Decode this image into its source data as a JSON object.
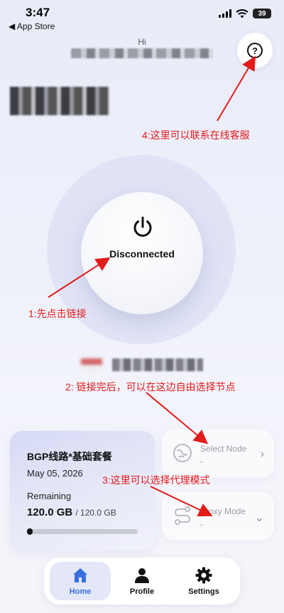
{
  "status_bar": {
    "time": "3:47",
    "back_app": "App Store",
    "battery": "39"
  },
  "header": {
    "greeting": "Hi"
  },
  "connection": {
    "status": "Disconnected"
  },
  "annotations": {
    "help": "4:这里可以联系在线客服",
    "connect": "1:先点击链接",
    "node": "2: 链接完后，可以在这边自由选择节点",
    "mode": "3:这里可以选择代理模式"
  },
  "plan": {
    "name": "BGP线路*基础套餐",
    "date": "May 05, 2026",
    "remaining_label": "Remaining",
    "remaining": "120.0 GB",
    "total": "/ 120.0 GB",
    "progress_fraction": 0.0
  },
  "node_card": {
    "label": "Select Node",
    "value": "-"
  },
  "mode_card": {
    "label": "Proxy Mode",
    "value": "-"
  },
  "tabs": [
    {
      "label": "Home",
      "icon": "home-icon",
      "active": true
    },
    {
      "label": "Profile",
      "icon": "profile-icon",
      "active": false
    },
    {
      "label": "Settings",
      "icon": "gear-icon",
      "active": false
    }
  ],
  "colors": {
    "accent": "#3a6fe0",
    "annotation": "#e21b1b"
  }
}
